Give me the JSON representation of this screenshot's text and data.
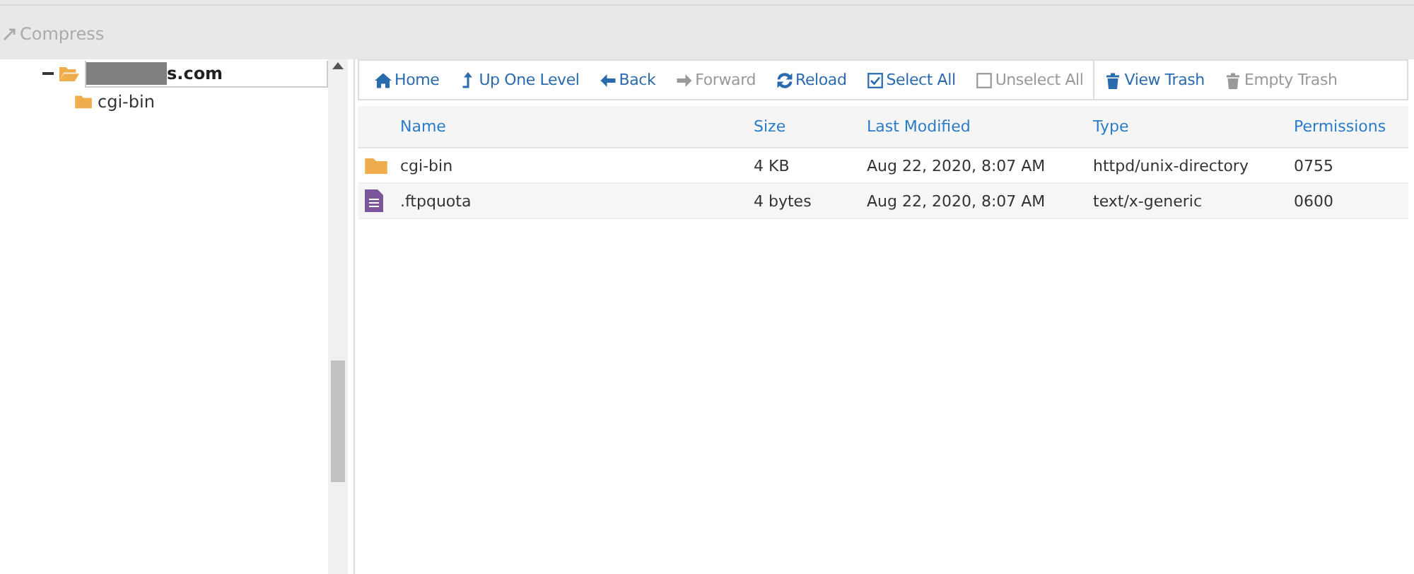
{
  "top_toolbar": {
    "compress": {
      "label": "Compress",
      "disabled": true
    }
  },
  "tree": {
    "root": {
      "label": "s.com",
      "redacted": true,
      "expanded": true,
      "selected": true,
      "children": [
        {
          "label": "cgi-bin"
        }
      ]
    }
  },
  "actions": [
    {
      "label": "Home",
      "disabled": false
    },
    {
      "label": "Up One Level",
      "disabled": false
    },
    {
      "label": "Back",
      "disabled": false
    },
    {
      "label": "Forward",
      "disabled": true
    },
    {
      "label": "Reload",
      "disabled": false
    },
    {
      "label": "Select All",
      "disabled": false
    },
    {
      "label": "Unselect All",
      "disabled": true
    },
    {
      "label": "View Trash",
      "disabled": false,
      "separator": true
    },
    {
      "label": "Empty Trash",
      "disabled": true
    }
  ],
  "table": {
    "columns": [
      "Name",
      "Size",
      "Last Modified",
      "Type",
      "Permissions"
    ],
    "rows": [
      {
        "kind": "folder",
        "cells": [
          "cgi-bin",
          "4 KB",
          "Aug 22, 2020, 8:07 AM",
          "httpd/unix-directory",
          "0755"
        ]
      },
      {
        "kind": "file",
        "cells": [
          ".ftpquota",
          "4 bytes",
          "Aug 22, 2020, 8:07 AM",
          "text/x-generic",
          "0600"
        ]
      }
    ]
  }
}
